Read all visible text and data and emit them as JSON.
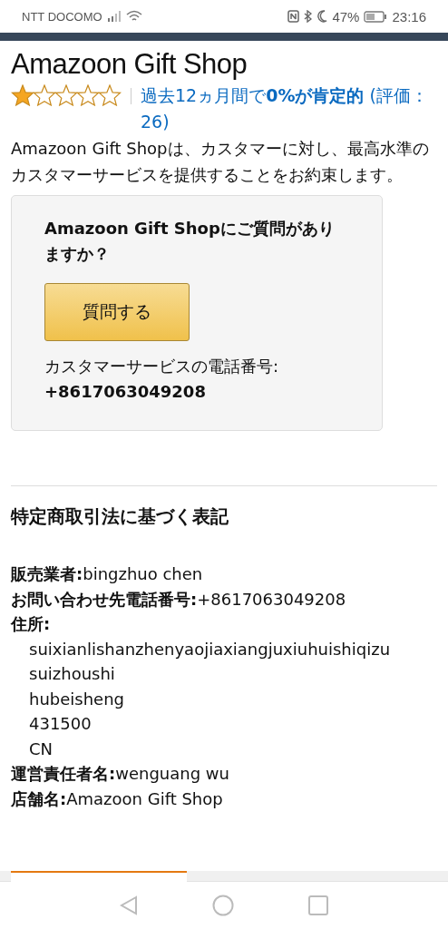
{
  "status_bar": {
    "carrier": "NTT DOCOMO",
    "battery": "47%",
    "time": "23:16"
  },
  "store": {
    "title": "Amazoon Gift Shop",
    "stars": 1,
    "rating_text": "過去12ヵ月間で**0%が肯定的** (評価：26)",
    "description": "Amazoon Gift Shopは、カスタマーに対し、最高水準のカスタマーサービスを提供することをお約束します。"
  },
  "contact_card": {
    "question": "Amazoon Gift Shopにご質問がありますか？",
    "button": "質問する",
    "phone_label": "カスタマーサービスの電話番号:",
    "phone": "+8617063049208"
  },
  "legal": {
    "heading": "特定商取引法に基づく表記",
    "entries": [
      {
        "kind": "inline",
        "label": "販売業者:",
        "value": "bingzhuo chen"
      },
      {
        "kind": "inline",
        "label": "お問い合わせ先電話番号:",
        "value": "+8617063049208"
      },
      {
        "kind": "block",
        "label": "住所:",
        "lines": [
          "suixianlishanzhenyaojiaxiangjuxiuhuishiqizu",
          "suizhoushi",
          "hubeisheng",
          "431500",
          "CN"
        ]
      },
      {
        "kind": "inline",
        "label": "運営責任者名:",
        "value": "wenguang wu"
      },
      {
        "kind": "inline",
        "label": "店舗名:",
        "value": "Amazoon Gift Shop"
      }
    ]
  }
}
